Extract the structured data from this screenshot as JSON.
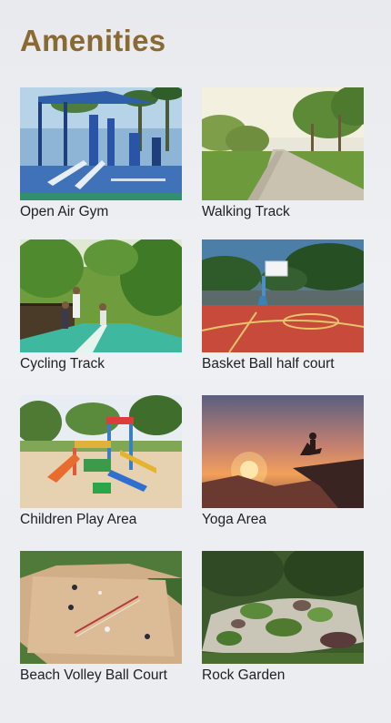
{
  "page": {
    "title": "Amenities"
  },
  "amenities": [
    {
      "label": "Open Air Gym",
      "image": "open-air-gym-photo"
    },
    {
      "label": "Walking Track",
      "image": "walking-track-photo"
    },
    {
      "label": "Cycling Track",
      "image": "cycling-track-photo"
    },
    {
      "label": "Basket Ball half court",
      "image": "basketball-court-photo"
    },
    {
      "label": "Children Play Area",
      "image": "children-play-area-photo"
    },
    {
      "label": "Yoga Area",
      "image": "yoga-area-photo"
    },
    {
      "label": "Beach Volley Ball Court",
      "image": "beach-volleyball-photo"
    },
    {
      "label": "Rock Garden",
      "image": "rock-garden-photo"
    }
  ],
  "colors": {
    "title": "#8a6a32",
    "label": "#1f1f1f",
    "background": "#eceef2"
  }
}
